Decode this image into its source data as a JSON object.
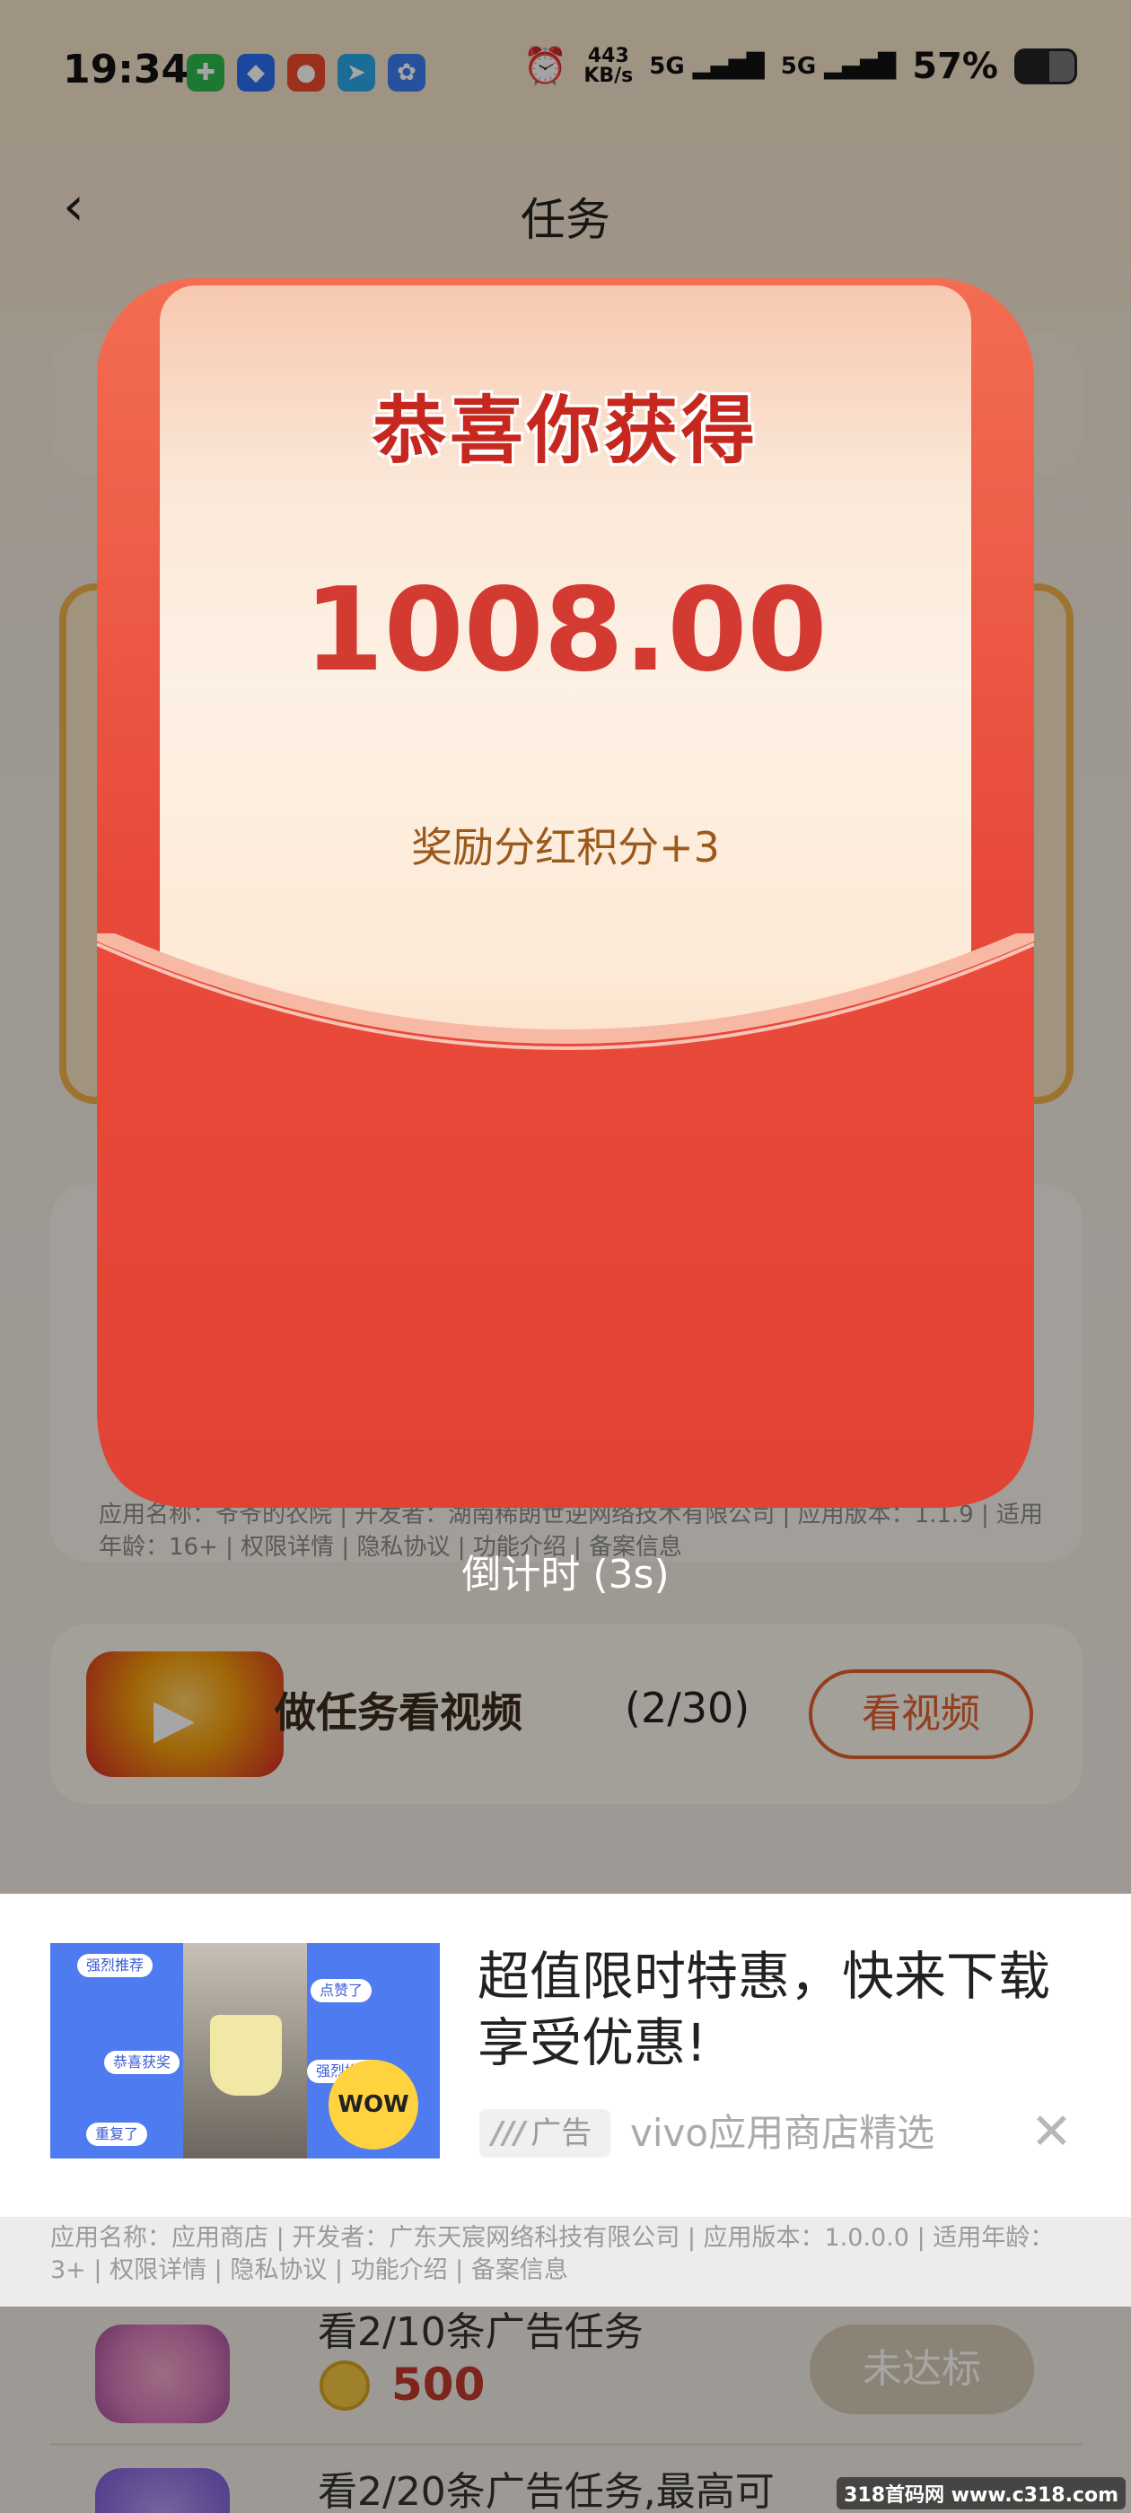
{
  "status": {
    "time": "19:34",
    "speed_value": "443",
    "speed_unit": "KB/s",
    "sig1": "5G",
    "sig2": "5G",
    "battery": "57%",
    "battery_level": 0.57
  },
  "nav": {
    "back_icon": "chevron-left-icon",
    "title": "任务"
  },
  "envelope": {
    "title": "恭喜你获得",
    "amount": "1008.00",
    "bonus": "奖励分红积分+3",
    "countdown": "倒计时 (3s)"
  },
  "bg": {
    "app_info": "应用名称：爷爷的农院 | 开发者：湖南稀朗世逆网络技术有限公司 | 应用版本：1.1.9 | 适用年龄：16+ | 权限详情 | 隐私协议 | 功能介绍 | 备案信息",
    "task": {
      "title": "做任务看视频",
      "count": "(2/30)",
      "button": "看视频"
    }
  },
  "ad": {
    "title": "超值限时特惠，快来下载享受优惠!",
    "badge": "广告",
    "source": "vivo应用商店精选",
    "close_icon": "close-icon",
    "image_tags": [
      "强烈推荐",
      "点赞了",
      "恭喜获奖",
      "强烈推荐",
      "重复了"
    ],
    "image_wow": "WOW",
    "info": "应用名称：应用商店 | 开发者：广东天宸网络科技有限公司 | 应用版本：1.0.0.0 | 适用年龄：3+ | 权限详情 | 隐私协议 | 功能介绍 | 备案信息"
  },
  "list": [
    {
      "title": "看2/10条广告任务",
      "coins": "500",
      "button": "未达标"
    },
    {
      "title": "看2/20条广告任务,最高可"
    }
  ],
  "watermark": "318首码网 www.c318.com"
}
